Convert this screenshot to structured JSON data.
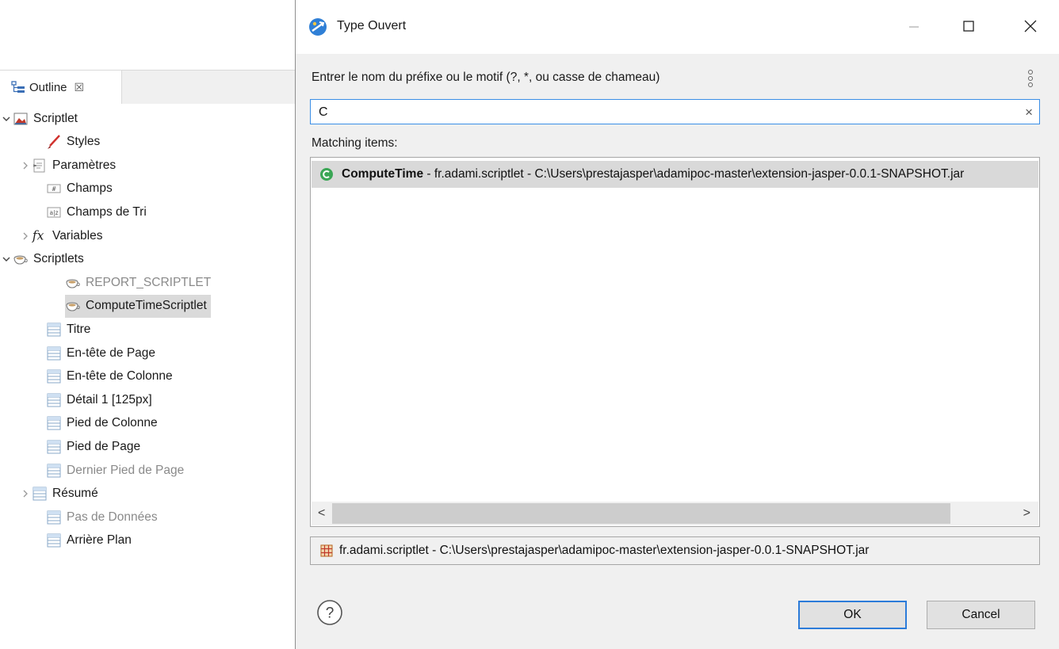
{
  "outline": {
    "tab_label": "Outline",
    "close_glyph": "☒",
    "items": [
      {
        "label": "Scriptlet",
        "icon": "report-icon",
        "expander": "expanded",
        "dim": false
      },
      {
        "label": "Styles",
        "icon": "brush-icon",
        "expander": "none",
        "dim": false
      },
      {
        "label": "Paramètres",
        "icon": "parameters-icon",
        "expander": "collapsed",
        "dim": false
      },
      {
        "label": "Champs",
        "icon": "fields-icon",
        "expander": "none",
        "dim": false
      },
      {
        "label": "Champs de Tri",
        "icon": "sort-fields-icon",
        "expander": "none",
        "dim": false
      },
      {
        "label": "Variables",
        "icon": "fx-icon",
        "expander": "collapsed",
        "dim": false
      },
      {
        "label": "Scriptlets",
        "icon": "coffee-cup-icon",
        "expander": "expanded",
        "dim": false
      },
      {
        "label": "REPORT_SCRIPTLET",
        "icon": "coffee-cup-icon",
        "expander": "none",
        "dim": true
      },
      {
        "label": "ComputeTimeScriptlet",
        "icon": "coffee-cup-icon",
        "expander": "none",
        "dim": false,
        "selected": true
      },
      {
        "label": "Titre",
        "icon": "band-icon",
        "expander": "none",
        "dim": false
      },
      {
        "label": "En-tête de Page",
        "icon": "band-icon",
        "expander": "none",
        "dim": false
      },
      {
        "label": "En-tête de Colonne",
        "icon": "band-icon",
        "expander": "none",
        "dim": false
      },
      {
        "label": "Détail 1 [125px]",
        "icon": "band-icon",
        "expander": "none",
        "dim": false
      },
      {
        "label": "Pied de Colonne",
        "icon": "band-icon",
        "expander": "none",
        "dim": false
      },
      {
        "label": "Pied de Page",
        "icon": "band-icon",
        "expander": "none",
        "dim": false
      },
      {
        "label": "Dernier Pied de Page",
        "icon": "band-icon",
        "expander": "none",
        "dim": true
      },
      {
        "label": "Résumé",
        "icon": "band-icon",
        "expander": "collapsed",
        "dim": false
      },
      {
        "label": "Pas de Données",
        "icon": "band-icon",
        "expander": "none",
        "dim": true
      },
      {
        "label": "Arrière Plan",
        "icon": "band-icon",
        "expander": "none",
        "dim": false
      }
    ]
  },
  "dialog": {
    "title": "Type Ouvert",
    "prompt": "Entrer le nom du préfixe ou le motif (?, *, ou casse de chameau)",
    "search": {
      "value": "C",
      "placeholder": ""
    },
    "clear_glyph": "×",
    "matching_label": "Matching items:",
    "results": [
      {
        "name": "ComputeTime",
        "rest": " - fr.adami.scriptlet - C:\\Users\\prestajasper\\adamipoc-master\\extension-jasper-0.0.1-SNAPSHOT.jar",
        "icon": "class-icon"
      }
    ],
    "details": "fr.adami.scriptlet - C:\\Users\\prestajasper\\adamipoc-master\\extension-jasper-0.0.1-SNAPSHOT.jar",
    "scroll_left": "<",
    "scroll_right": ">",
    "help_glyph": "?",
    "ok_label": "OK",
    "cancel_label": "Cancel"
  },
  "colors": {
    "selection": "#d9d9d9",
    "focus_border": "#2b7bd9",
    "class_icon_green": "#3aa655",
    "dialog_bg": "#f0f0f0"
  }
}
